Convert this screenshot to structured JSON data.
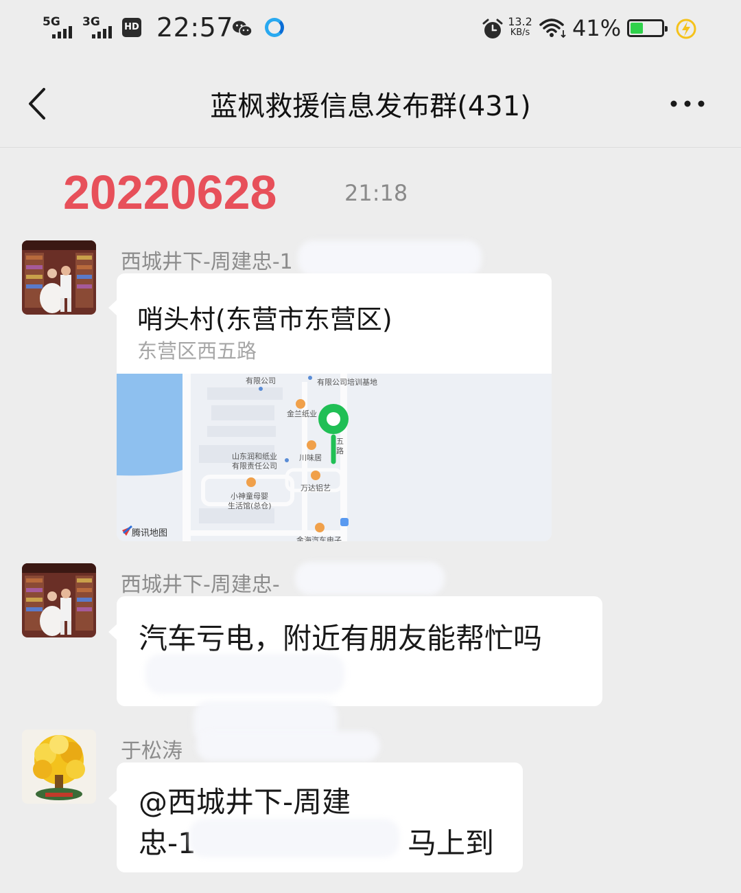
{
  "status_bar": {
    "signal1": "5G",
    "signal2": "3G",
    "hd_badge": "HD",
    "time": "22:57",
    "net_speed_value": "13.2",
    "net_speed_unit": "KB/s",
    "battery_percent": "41%",
    "battery_level": 0.41,
    "battery_color": "#2fd14b"
  },
  "header": {
    "title": "蓝枫救援信息发布群(431)",
    "back_icon": "back-arrow-icon",
    "more_icon": "more-dots-icon"
  },
  "date_banner": {
    "date": "20220628",
    "time": "21:18",
    "date_color": "#e7505a"
  },
  "messages": [
    {
      "sender": "西城井下-周建忠-1",
      "type": "location",
      "location_name": "哨头村(东营市东营区)",
      "location_address": "东营区西五路",
      "map": {
        "brand": "腾讯地图",
        "labels": [
          "有限公司",
          "有限公司培训基地",
          "金兰纸业",
          "山东润和纸业",
          "有限责任公司",
          "川味居",
          "万达铝艺",
          "小神童母婴",
          "生活馆(总仓)",
          "五",
          "路",
          "金海汽车电子"
        ]
      }
    },
    {
      "sender": "西城井下-周建忠-",
      "type": "text",
      "text": "汽车亏电，附近有朋友能帮忙吗"
    },
    {
      "sender": "于松涛",
      "type": "text",
      "text_line1": "@西城井下-周建",
      "text_line2_prefix": "忠-1",
      "text_line2_suffix": "马上到"
    }
  ]
}
